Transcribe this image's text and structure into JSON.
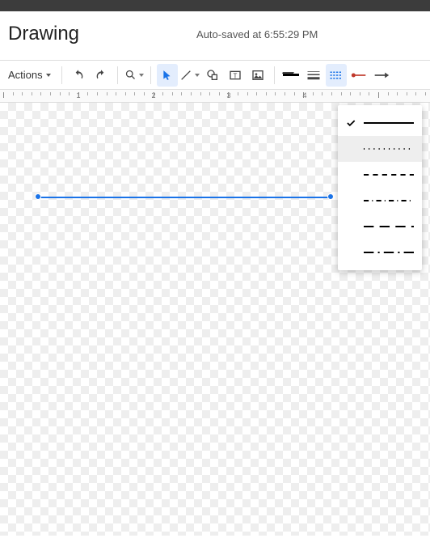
{
  "header": {
    "title": "Drawing",
    "autosave_text": "Auto-saved at 6:55:29 PM"
  },
  "toolbar": {
    "actions_label": "Actions"
  },
  "ruler": {
    "marks": [
      "1",
      "2",
      "3",
      "4"
    ]
  },
  "line_dash_options": [
    {
      "id": "solid",
      "selected": true
    },
    {
      "id": "dotted",
      "selected": false
    },
    {
      "id": "dashed-short",
      "selected": false
    },
    {
      "id": "dash-dot",
      "selected": false
    },
    {
      "id": "dashed-long",
      "selected": false
    },
    {
      "id": "long-dash-dot",
      "selected": false
    }
  ]
}
